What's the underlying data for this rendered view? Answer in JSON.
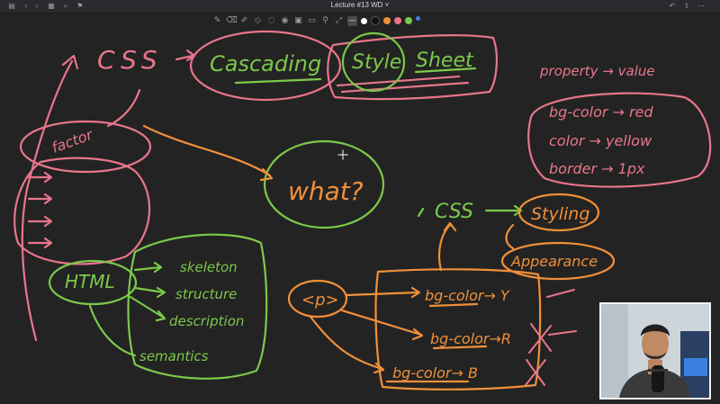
{
  "window": {
    "title": "Lecture #13 WD"
  },
  "toolbar": {
    "tools": [
      "pen-icon",
      "eraser-icon",
      "highlighter-icon",
      "shapes-icon",
      "lasso-icon",
      "text-icon",
      "image-icon",
      "camera-icon",
      "link-icon",
      "pointer-icon"
    ],
    "colors": [
      "#ffffff",
      "#111111",
      "#f0903a",
      "#e8768a",
      "#7cc94a",
      "#3a7ce8"
    ]
  },
  "board": {
    "css_top": "CSS",
    "cascading": "Cascading",
    "style": "Style",
    "sheet": "Sheet",
    "factor": "factor",
    "what": "what?",
    "property_value": "property → value",
    "rule1": "bg-color → red",
    "rule2": "color → yellow",
    "rule3": "border → 1px",
    "css_mid": "CSS",
    "styling": "Styling",
    "appearance": "Appearance",
    "p_tag": "<p>",
    "bg1": "bg-color→ Y",
    "bg2": "bg-color→R",
    "bg3": "bg-color→ B",
    "html": "HTML",
    "skeleton": "skeleton",
    "structure": "structure",
    "description": "description",
    "semantics": "semantics"
  },
  "colors": {
    "pink": "#e8768a",
    "green": "#7cc94a",
    "orange": "#f0903a"
  }
}
